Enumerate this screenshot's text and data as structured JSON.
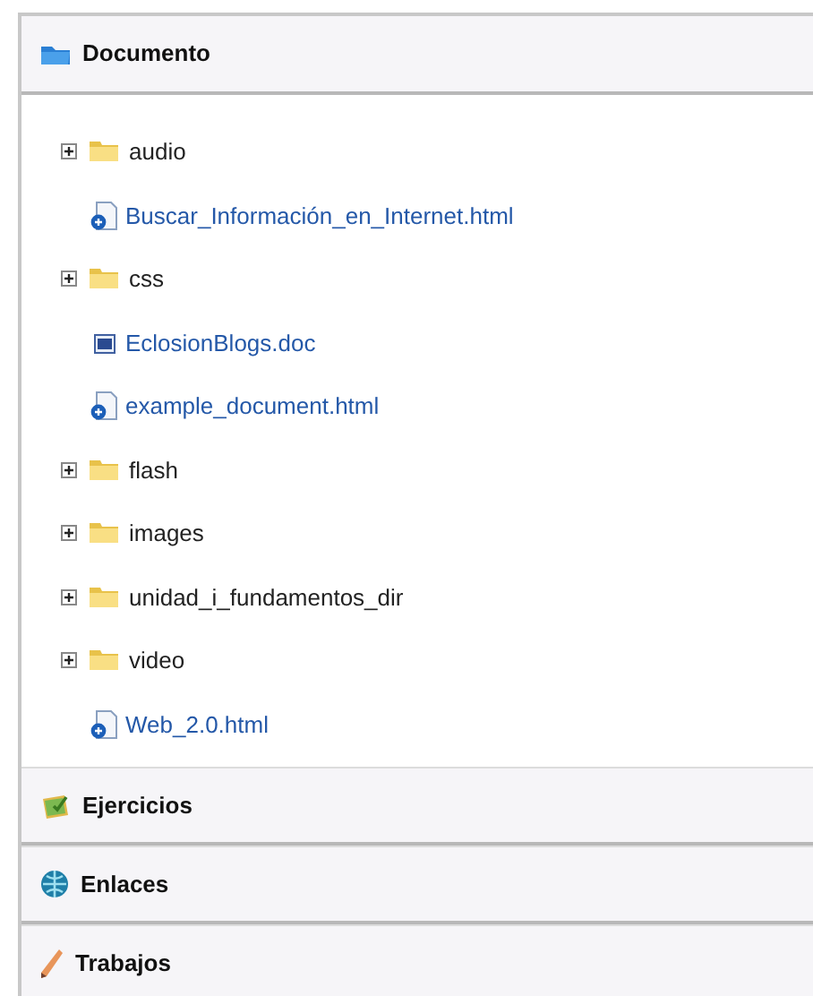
{
  "sections": [
    {
      "title": "Documento",
      "items": [
        {
          "kind": "folder",
          "name": "audio",
          "expanded": false
        },
        {
          "kind": "html",
          "name": "Buscar_Información_en_Internet.html"
        },
        {
          "kind": "folder",
          "name": "css",
          "expanded": false
        },
        {
          "kind": "doc",
          "name": "EclosionBlogs.doc"
        },
        {
          "kind": "html",
          "name": "example_document.html"
        },
        {
          "kind": "folder",
          "name": "flash",
          "expanded": false
        },
        {
          "kind": "folder",
          "name": "images",
          "expanded": false
        },
        {
          "kind": "folder",
          "name": "unidad_i_fundamentos_dir",
          "expanded": false
        },
        {
          "kind": "folder",
          "name": "video",
          "expanded": false
        },
        {
          "kind": "html",
          "name": "Web_2.0.html"
        }
      ]
    },
    {
      "title": "Ejercicios"
    },
    {
      "title": "Enlaces"
    },
    {
      "title": "Trabajos"
    }
  ]
}
